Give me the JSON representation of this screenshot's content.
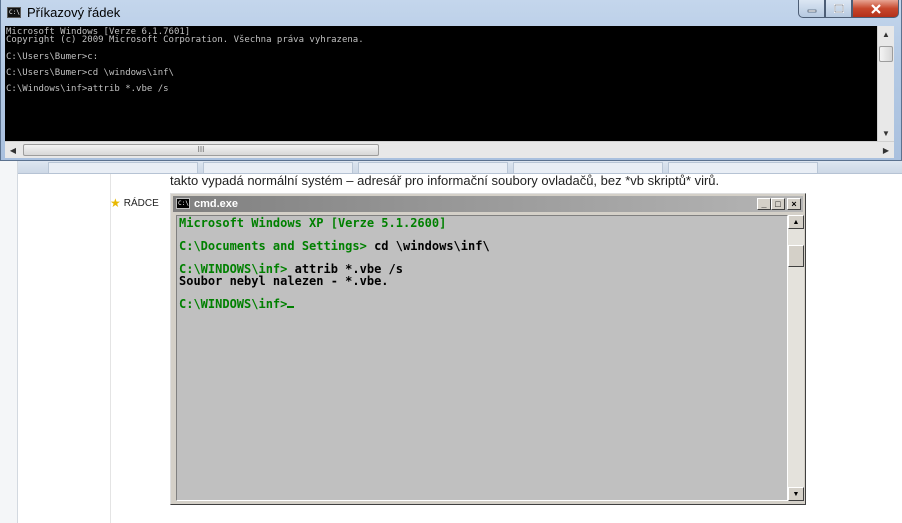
{
  "win7": {
    "title": "Příkazový řádek",
    "icon_text": "C:\\",
    "icon": "cmd-icon",
    "controls": {
      "minimize": "minimize-icon",
      "maximize": "maximize-icon",
      "close": "close-icon"
    },
    "lines": [
      "Microsoft Windows [Verze 6.1.7601]",
      "Copyright (c) 2009 Microsoft Corporation. Všechna práva vyhrazena.",
      "",
      "C:\\Users\\Bumer>c:",
      "",
      "C:\\Users\\Bumer>cd \\windows\\inf\\",
      "",
      "C:\\Windows\\inf>attrib *.vbe /s"
    ],
    "hthumb_grip": "III"
  },
  "background_page": {
    "article_text": "takto vypadá normální systém – adresář pro informační soubory ovladačů, bez *vb skriptů* virů.",
    "logo_text": "",
    "radce_label": "RÁDCE",
    "star_icon": "star-icon"
  },
  "winxp": {
    "title": "cmd.exe",
    "icon_text": "C:\\",
    "buttons": {
      "minimize": "_",
      "maximize": "□",
      "close": "×"
    },
    "lines": [
      {
        "text": "Microsoft Windows XP [Verze 5.1.2600]",
        "style": "green"
      },
      {
        "text": "",
        "style": "green"
      },
      {
        "text": "C:\\Documents and Settings> cd \\windows\\inf\\",
        "prompt": "C:\\Documents and Settings>",
        "command": " cd \\windows\\inf\\"
      },
      {
        "text": "",
        "style": "green"
      },
      {
        "text": "C:\\WINDOWS\\inf> attrib *.vbe /s",
        "prompt": "C:\\WINDOWS\\inf>",
        "command": " attrib *.vbe /s"
      },
      {
        "text": "Soubor nebyl nalezen - *.vbe.",
        "style": "plain"
      },
      {
        "text": "",
        "style": "green"
      },
      {
        "text": "C:\\WINDOWS\\inf>",
        "prompt": "C:\\WINDOWS\\inf>",
        "command": ""
      }
    ]
  },
  "colors": {
    "xp_console_bg": "#c0c0c0",
    "xp_prompt": "#008000",
    "win7_console_bg": "#000000",
    "win7_console_fg": "#c0c0c0"
  }
}
